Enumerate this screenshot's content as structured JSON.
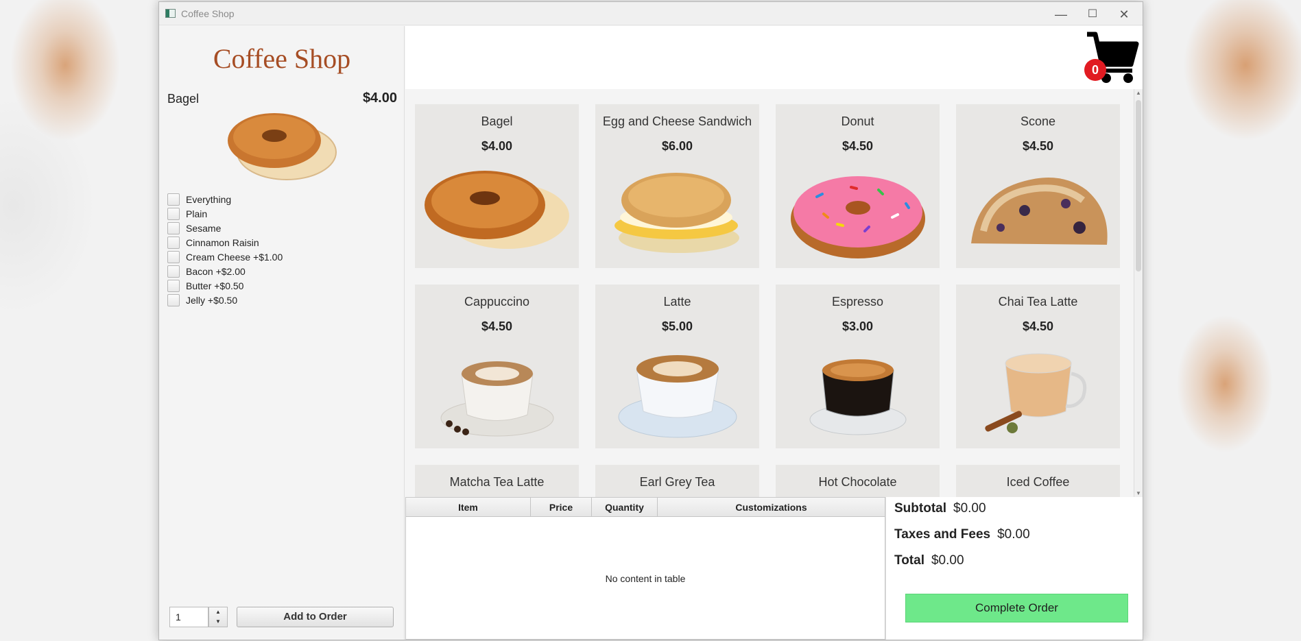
{
  "window": {
    "title": "Coffee Shop",
    "minimize": "—",
    "maximize": "☐",
    "close": "✕"
  },
  "sidebar": {
    "shop_title": "Coffee Shop",
    "selected_item": {
      "name": "Bagel",
      "price": "$4.00"
    },
    "options": [
      "Everything",
      "Plain",
      "Sesame",
      "Cinnamon Raisin",
      "Cream Cheese +$1.00",
      "Bacon +$2.00",
      "Butter +$0.50",
      "Jelly +$0.50"
    ],
    "quantity": "1",
    "spin_up": "▲",
    "spin_down": "▼",
    "add_button": "Add to Order"
  },
  "cart": {
    "count": "0"
  },
  "menu": {
    "items": [
      {
        "name": "Bagel",
        "price": "$4.00"
      },
      {
        "name": "Egg and Cheese Sandwich",
        "price": "$6.00"
      },
      {
        "name": "Donut",
        "price": "$4.50"
      },
      {
        "name": "Scone",
        "price": "$4.50"
      },
      {
        "name": "Cappuccino",
        "price": "$4.50"
      },
      {
        "name": "Latte",
        "price": "$5.00"
      },
      {
        "name": "Espresso",
        "price": "$3.00"
      },
      {
        "name": "Chai Tea Latte",
        "price": "$4.50"
      },
      {
        "name": "Matcha Tea Latte",
        "price": ""
      },
      {
        "name": "Earl Grey Tea",
        "price": ""
      },
      {
        "name": "Hot Chocolate",
        "price": ""
      },
      {
        "name": "Iced Coffee",
        "price": ""
      }
    ]
  },
  "order_table": {
    "columns": [
      "Item",
      "Price",
      "Quantity",
      "Customizations"
    ],
    "empty_message": "No content in table"
  },
  "totals": {
    "subtotal_label": "Subtotal",
    "subtotal": "$0.00",
    "taxes_label": "Taxes and Fees",
    "taxes": "$0.00",
    "total_label": "Total",
    "total": "$0.00",
    "complete_button": "Complete Order"
  },
  "colors": {
    "title": "#a64d24",
    "complete_button": "#6ee88a",
    "cart_badge": "#e11b22"
  }
}
